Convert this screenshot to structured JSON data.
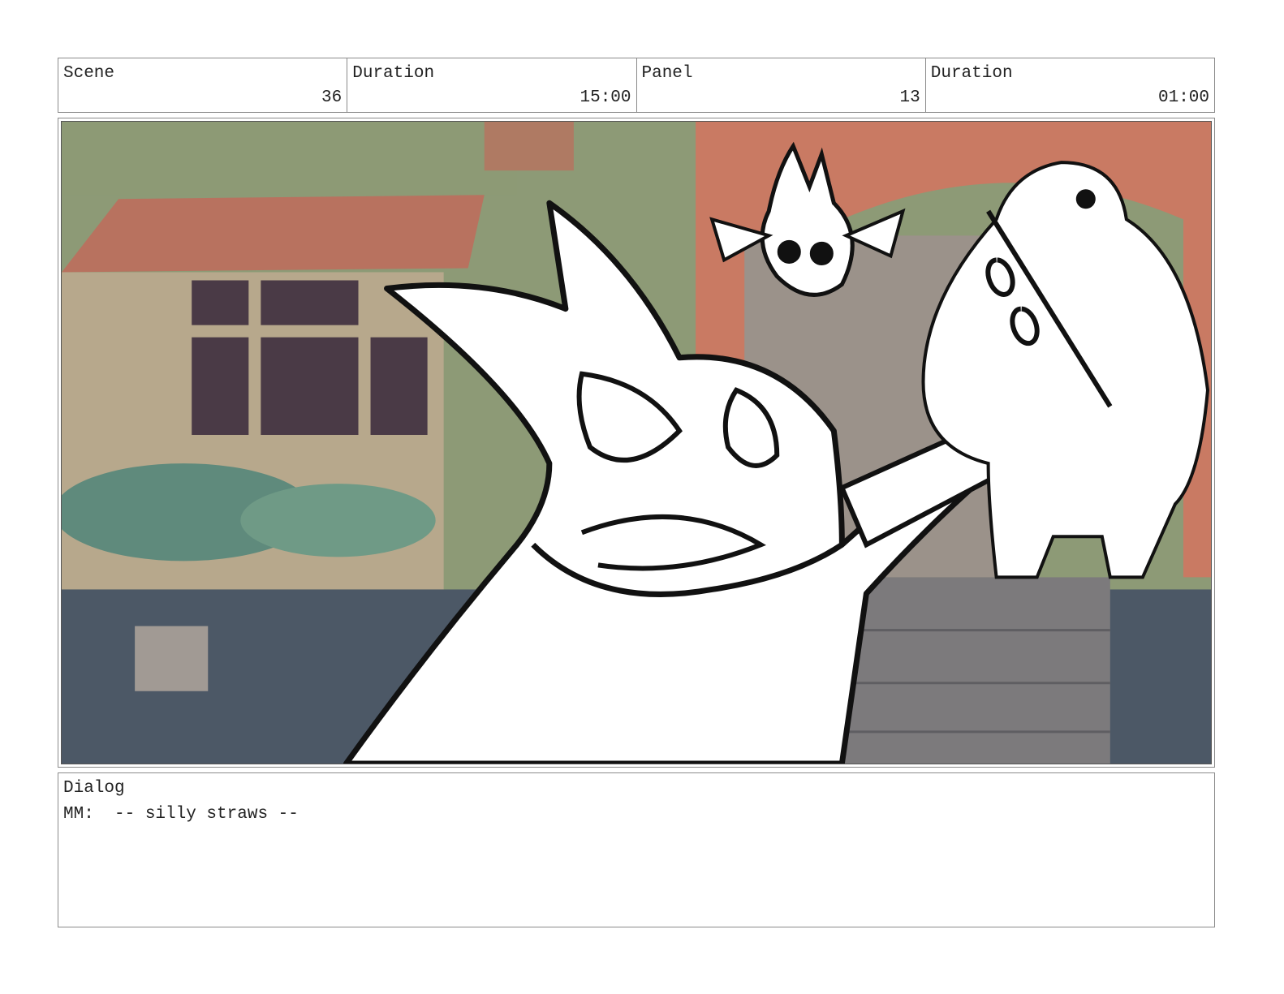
{
  "header": {
    "cells": [
      {
        "label": "Scene",
        "value": "36"
      },
      {
        "label": "Duration",
        "value": "15:00"
      },
      {
        "label": "Panel",
        "value": "13"
      },
      {
        "label": "Duration",
        "value": "01:00"
      }
    ]
  },
  "panel": {
    "colors": {
      "sky": "#8d9a76",
      "roof": "#b8725f",
      "window": "#4a3a46",
      "ground": "#4c5866",
      "steps": "#7c7a7c",
      "arch": "#c97a63",
      "ink": "#111111",
      "paper": "#ffffff"
    }
  },
  "dialog": {
    "label": "Dialog",
    "line": "MM:  -- silly straws --"
  }
}
